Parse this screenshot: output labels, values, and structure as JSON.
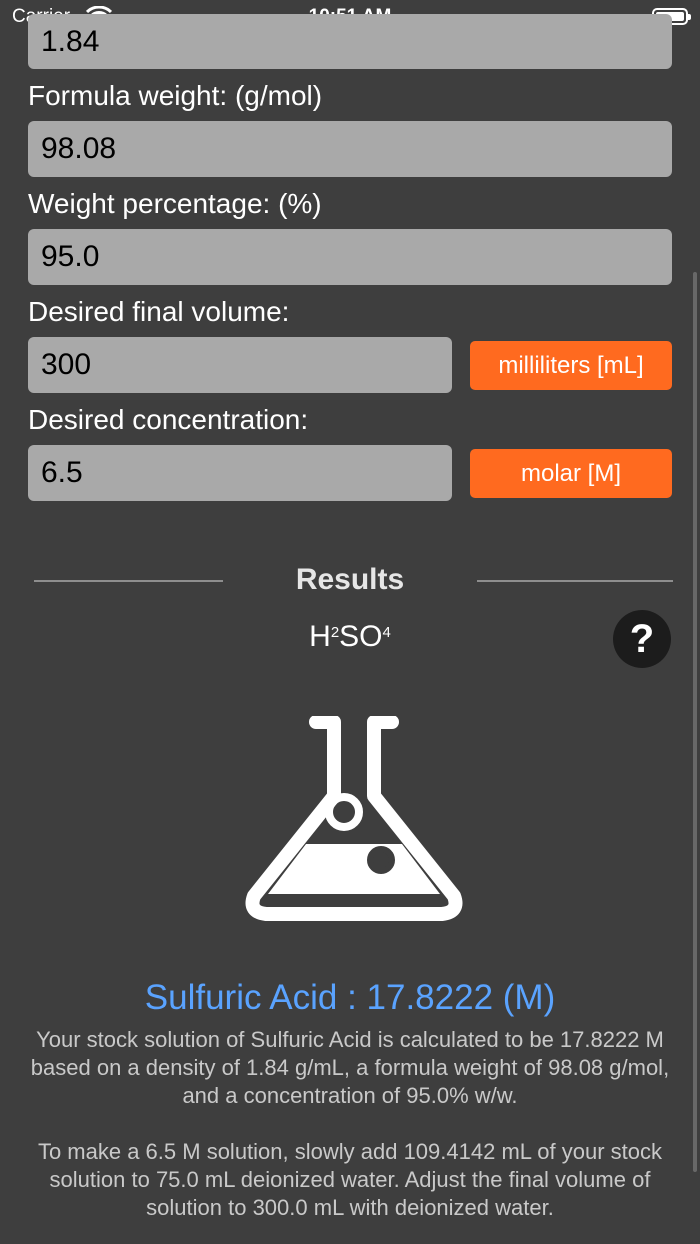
{
  "status_bar": {
    "carrier": "Carrier",
    "time": "10:51 AM"
  },
  "fields": {
    "density_value": "1.84",
    "formula_weight_label": "Formula weight:  (g/mol)",
    "formula_weight_value": "98.08",
    "weight_percentage_label": "Weight percentage:  (%)",
    "weight_percentage_value": "95.0",
    "final_volume_label": "Desired final volume:",
    "final_volume_value": "300",
    "final_volume_unit": "milliliters [mL]",
    "concentration_label": "Desired concentration:",
    "concentration_value": "6.5",
    "concentration_unit": "molar [M]"
  },
  "results": {
    "title": "Results",
    "formula_parts": {
      "h": "H",
      "h_sub": "2",
      "so": "SO",
      "so_sub": "4"
    },
    "help_symbol": "?",
    "icon": "flask-icon",
    "headline": "Sulfuric Acid : 17.8222 (M)",
    "description1": "Your stock solution of Sulfuric Acid is calculated to be 17.8222 M based on a density of 1.84 g/mL, a formula weight of 98.08 g/mol, and a concentration of 95.0% w/w.",
    "description2": "To make a 6.5 M solution, slowly add 109.4142 mL of your stock solution to 75.0 mL deionized water. Adjust the final volume of solution to 300.0 mL with deionized water."
  },
  "colors": {
    "background": "#3e3e3e",
    "field": "#a9a9a9",
    "accent": "#ff6a1f",
    "headline": "#5aa3ff"
  }
}
